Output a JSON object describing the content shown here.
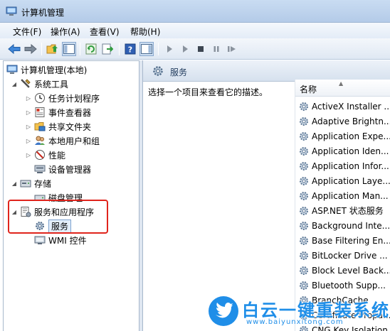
{
  "window": {
    "title": "计算机管理"
  },
  "menu": [
    {
      "label": "文件(F)"
    },
    {
      "label": "操作(A)"
    },
    {
      "label": "查看(V)"
    },
    {
      "label": "帮助(H)"
    }
  ],
  "tree": {
    "root": "计算机管理(本地)",
    "system_tools": "系统工具",
    "task_scheduler": "任务计划程序",
    "event_viewer": "事件查看器",
    "shared_folders": "共享文件夹",
    "local_users": "本地用户和组",
    "performance": "性能",
    "device_manager": "设备管理器",
    "storage": "存储",
    "disk_management": "磁盘管理",
    "services_apps": "服务和应用程序",
    "services": "服务",
    "wmi": "WMI 控件"
  },
  "right_pane": {
    "title": "服务",
    "description": "选择一个项目来查看它的描述。",
    "column_name": "名称"
  },
  "services": [
    "ActiveX Installer ...",
    "Adaptive Brightn...",
    "Application Expe...",
    "Application Iden...",
    "Application Infor...",
    "Application Laye...",
    "Application Man...",
    "ASP.NET 状态服务",
    "Background Inte...",
    "Base Filtering En...",
    "BitLocker Drive ...",
    "Block Level Back...",
    "Bluetooth Supp...",
    "BranchCache",
    "Certificate Propa...",
    "CNG Key Isolation"
  ],
  "watermark": {
    "text": "白云一键重装系统",
    "url": "www.baiyunxitong.com"
  },
  "colors": {
    "highlight_box": "#e0241c",
    "watermark": "#1f8ee8"
  }
}
